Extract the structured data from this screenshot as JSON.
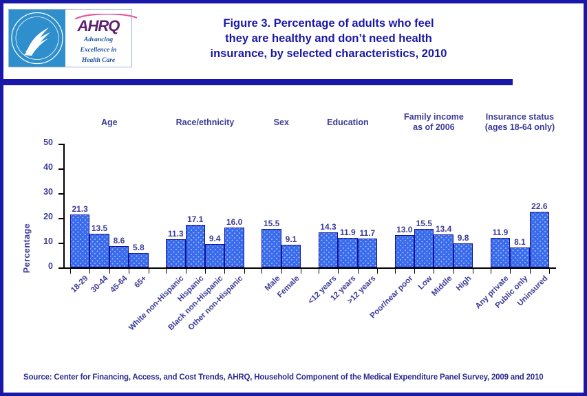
{
  "window": {
    "border_color": "#1a18a8",
    "background": "#ffffff"
  },
  "header": {
    "title": "Figure 3. Percentage of adults who feel they are healthy and don’t need health insurance, by selected characteristics, 2010",
    "title_line1": "Figure 3. Percentage of adults who feel",
    "title_line2": "they are healthy and don’t need health",
    "title_line3": "insurance, by selected characteristics, 2010",
    "logo": {
      "seal_name": "hhs-seal-icon",
      "seal_text": "DEPARTMENT OF HEALTH & HUMAN SERVICES · USA",
      "wordmark": "AHRQ",
      "tagline_line1": "Advancing",
      "tagline_line2": "Excellence in",
      "tagline_line3": "Health Care"
    }
  },
  "footer": {
    "source": "Source: Center for Financing, Access, and Cost Trends, AHRQ,  Household Component of the Medical Expenditure Panel Survey,  2009 and 2010"
  },
  "chart_data": {
    "type": "bar",
    "title": "Figure 3. Percentage of adults who feel they are healthy and don’t need health insurance, by selected characteristics, 2010",
    "xlabel": "",
    "ylabel": "Percentage",
    "ylim": [
      0,
      50
    ],
    "yticks": [
      0,
      10,
      20,
      30,
      40,
      50
    ],
    "grid": false,
    "legend": "none",
    "bar_color": "#3a6bec",
    "bar_border_color": "#11119a",
    "text_color": "#3b3b98",
    "categories": [
      "18-29",
      "30-44",
      "45-64",
      "65+",
      "White non-Hispanic",
      "Hispanic",
      "Black non-Hispanic",
      "Other non-Hispanic",
      "Male",
      "Female",
      "<12 years",
      "12 years",
      ">12 years",
      "Poor/near poor",
      "Low",
      "Middle",
      "High",
      "Any private",
      "Public only",
      "Uninsured"
    ],
    "values": [
      21.3,
      13.5,
      8.6,
      5.8,
      11.3,
      17.1,
      9.4,
      16.0,
      15.5,
      9.1,
      14.3,
      11.9,
      11.7,
      13.0,
      15.5,
      13.4,
      9.8,
      11.9,
      8.1,
      22.6
    ],
    "groups": [
      {
        "label": "Age",
        "label_line1": "Age",
        "label_line2": "",
        "start": 0,
        "count": 4
      },
      {
        "label": "Race/ethnicity",
        "label_line1": "Race/ethnicity",
        "label_line2": "",
        "start": 4,
        "count": 4
      },
      {
        "label": "Sex",
        "label_line1": "Sex",
        "label_line2": "",
        "start": 8,
        "count": 2
      },
      {
        "label": "Education",
        "label_line1": "Education",
        "label_line2": "",
        "start": 10,
        "count": 3
      },
      {
        "label": "Family income as of 2006",
        "label_line1": "Family income",
        "label_line2": "as of 2006",
        "start": 13,
        "count": 4
      },
      {
        "label": "Insurance status (ages 18-64 only)",
        "label_line1": "Insurance status",
        "label_line2": "(ages 18-64  only)",
        "start": 17,
        "count": 3
      }
    ]
  }
}
